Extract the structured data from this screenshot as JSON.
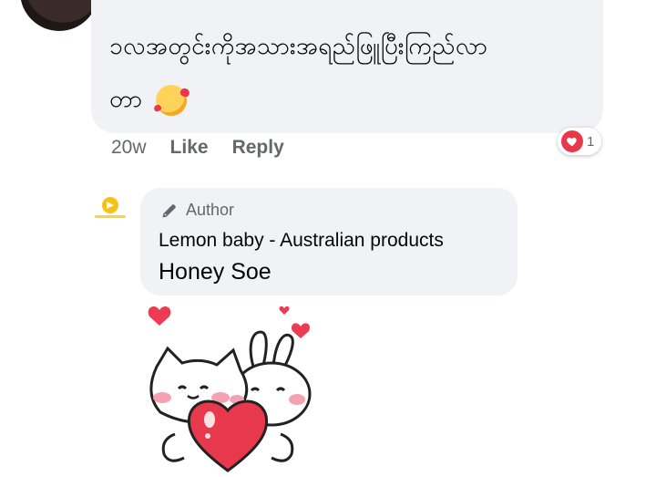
{
  "comment": {
    "text": "ၥလအတွင်းကိုအသားအရည်ဖြူပြီးကြည်လာ",
    "text_line2": "တာ",
    "emoji": "smiling-face-with-hearts",
    "time": "20w",
    "like_label": "Like",
    "reply_label": "Reply",
    "reaction_count": "1"
  },
  "reply": {
    "badge_label": "Author",
    "page_name": "Lemon baby - Australian products",
    "text": "Honey Soe",
    "sticker": "cat-and-bunny-holding-heart-sticker"
  },
  "colors": {
    "bubble": "#f0f2f5",
    "meta_text": "#65676b",
    "heart_red": "#e8394c"
  }
}
